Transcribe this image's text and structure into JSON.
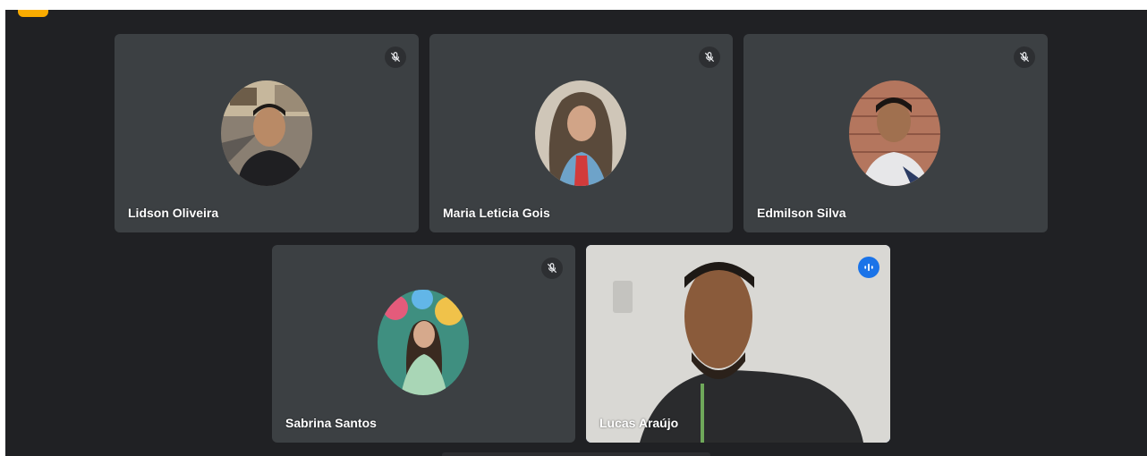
{
  "participants": [
    {
      "name": "Lidson Oliveira",
      "muted": true
    },
    {
      "name": "Maria Leticia Gois",
      "muted": true
    },
    {
      "name": "Edmilson Silva",
      "muted": true
    },
    {
      "name": "Sabrina Santos",
      "muted": true
    },
    {
      "name": "Lucas Araújo",
      "speaking": true
    }
  ],
  "icons": {
    "muted": "mic-off-icon",
    "speaking": "audio-wave-icon"
  },
  "colors": {
    "background": "#202124",
    "tile": "#3c4043",
    "active_border": "#8ab4f8",
    "speaking_badge": "#1a73e8"
  }
}
